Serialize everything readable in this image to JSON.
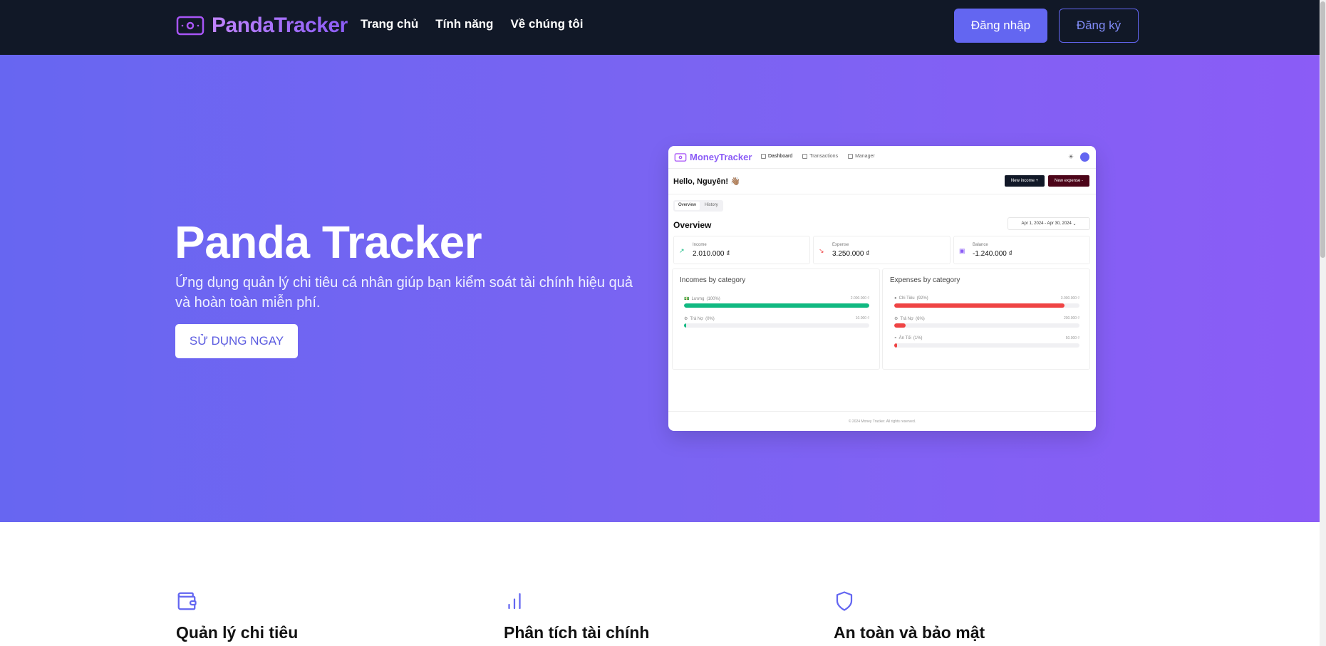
{
  "nav": {
    "brand": "PandaTracker",
    "links": [
      "Trang chủ",
      "Tính năng",
      "Về chúng tôi"
    ],
    "login": "Đăng nhập",
    "signup": "Đăng ký"
  },
  "hero": {
    "title": "Panda Tracker",
    "subtitle": "Ứng dụng quản lý chi tiêu cá nhân giúp bạn kiểm soát tài chính hiệu quả và hoàn toàn miễn phí.",
    "cta": "SỬ DỤNG NGAY"
  },
  "mockup": {
    "brand": "MoneyTracker",
    "nav": [
      "Dashboard",
      "Transactions",
      "Manager"
    ],
    "hello": "Hello, Nguyên! 👋🏽",
    "new_income": "New income +",
    "new_expense": "New expense -",
    "tabs": [
      "Overview",
      "History"
    ],
    "overview_title": "Overview",
    "date_range": "Apr 1, 2024 - Apr 30, 2024",
    "cards": [
      {
        "label": "Income",
        "value": "2.010.000 ₫",
        "icon": "trending-up-icon",
        "color": "#10b981"
      },
      {
        "label": "Expense",
        "value": "3.250.000 ₫",
        "icon": "trending-down-icon",
        "color": "#ef4444"
      },
      {
        "label": "Balance",
        "value": "-1.240.000 ₫",
        "icon": "wallet-icon",
        "color": "#8b5cf6"
      }
    ],
    "incomes_title": "Incomes by category",
    "incomes": [
      {
        "label": "Lương",
        "pct": "(100%)",
        "amount": "2.000.000 ₫",
        "fill": 1.0
      },
      {
        "label": "Trả Nợ",
        "pct": "(0%)",
        "amount": "10.000 ₫",
        "fill": 0.005
      }
    ],
    "expenses_title": "Expenses by category",
    "expenses": [
      {
        "label": "Chi Tiêu",
        "pct": "(92%)",
        "amount": "3.000.000 ₫",
        "fill": 0.92
      },
      {
        "label": "Trả Nợ",
        "pct": "(6%)",
        "amount": "200.000 ₫",
        "fill": 0.06
      },
      {
        "label": "Ăn Tối",
        "pct": "(1%)",
        "amount": "50.000 ₫",
        "fill": 0.015
      }
    ],
    "footer": "© 2024 Money Tracker. All rights reserved.",
    "income_color": "#10b981",
    "expense_color": "#ef4444"
  },
  "features": [
    {
      "title": "Quản lý chi tiêu",
      "icon": "wallet-icon"
    },
    {
      "title": "Phân tích tài chính",
      "icon": "bar-chart-icon"
    },
    {
      "title": "An toàn và bảo mật",
      "icon": "shield-icon"
    }
  ],
  "colors": {
    "accent": "#6366f1",
    "navbar": "#111827"
  }
}
